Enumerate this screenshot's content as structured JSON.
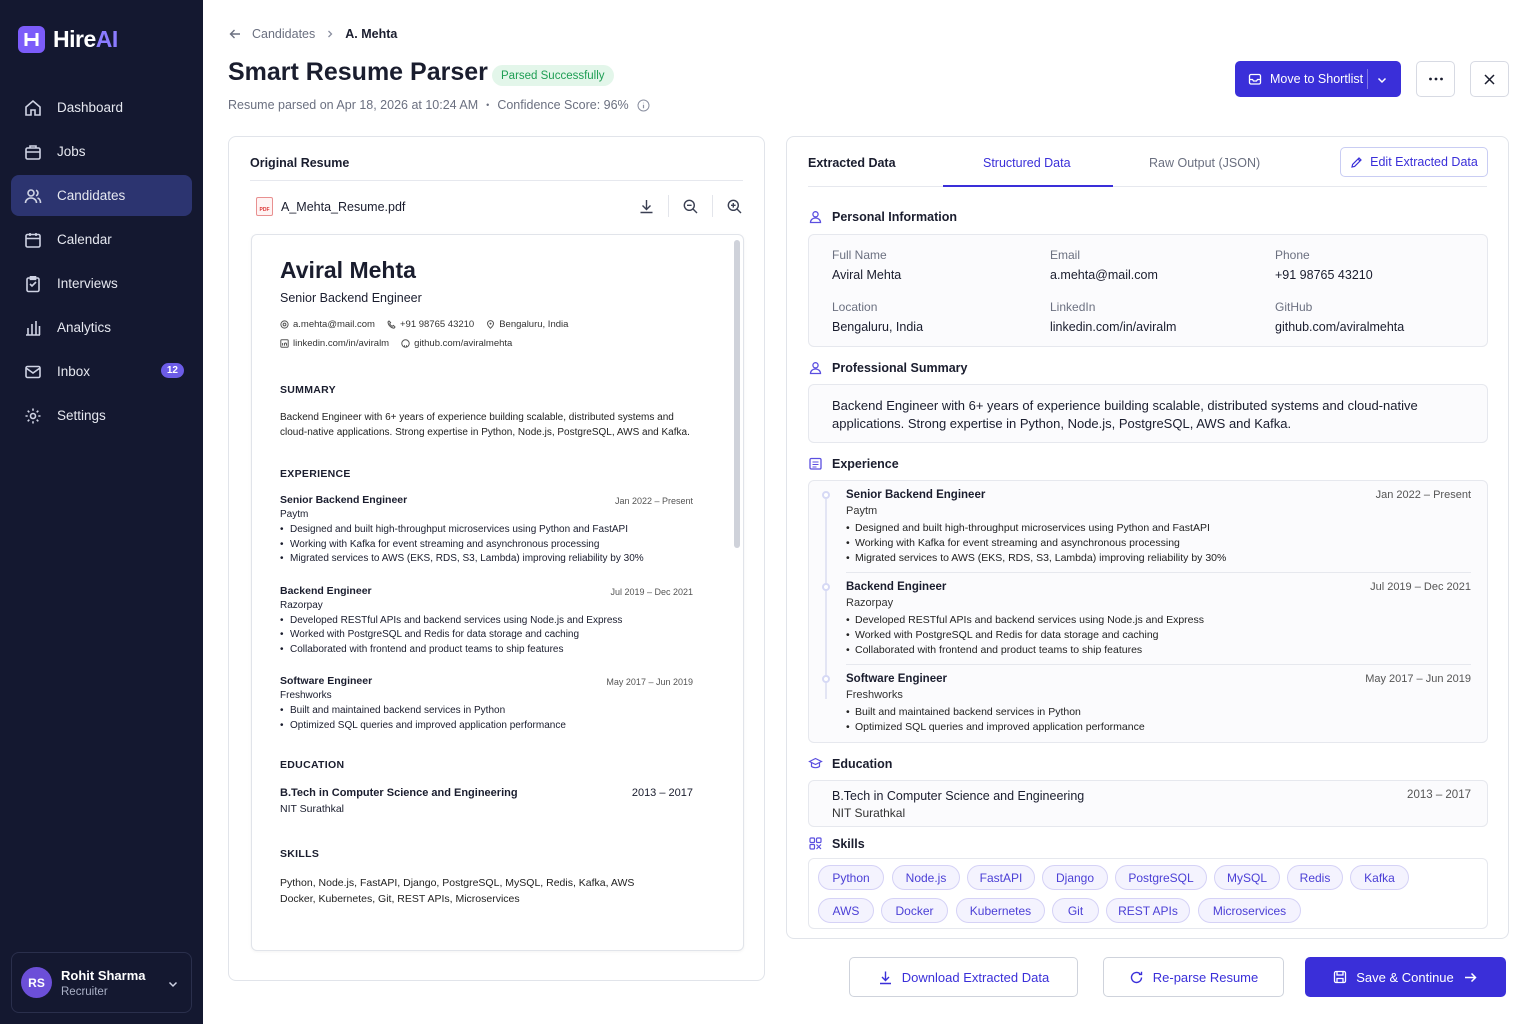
{
  "app": {
    "brand_a": "Hire",
    "brand_b": "AI"
  },
  "nav": {
    "items": [
      {
        "label": "Dashboard",
        "icon": "home-icon"
      },
      {
        "label": "Jobs",
        "icon": "briefcase-icon"
      },
      {
        "label": "Candidates",
        "icon": "users-icon",
        "active": true
      },
      {
        "label": "Calendar",
        "icon": "calendar-icon"
      },
      {
        "label": "Interviews",
        "icon": "clipboard-icon"
      },
      {
        "label": "Analytics",
        "icon": "bar-chart-icon"
      },
      {
        "label": "Inbox",
        "icon": "mail-icon",
        "badge": "12"
      },
      {
        "label": "Settings",
        "icon": "gear-icon"
      }
    ]
  },
  "user": {
    "initials": "RS",
    "name": "Rohit Sharma",
    "role": "Recruiter"
  },
  "breadcrumb": {
    "parent": "Candidates",
    "current": "A. Mehta"
  },
  "header": {
    "title": "Smart Resume Parser",
    "status": "Parsed Successfully",
    "parsed_on": "Resume parsed on Apr 18, 2026 at 10:24 AM",
    "dot": "•",
    "confidence": "Confidence Score: 96%",
    "primary_action": "Move to Shortlist"
  },
  "original": {
    "title": "Original Resume",
    "file_name": "A_Mehta_Resume.pdf",
    "pdf_label": "PDF",
    "doc": {
      "name": "Aviral Mehta",
      "role": "Senior Backend Engineer",
      "email": "a.mehta@mail.com",
      "phone": "+91 98765 43210",
      "location": "Bengaluru, India",
      "linkedin": "linkedin.com/in/aviralm",
      "github": "github.com/aviralmehta",
      "summary_h": "SUMMARY",
      "summary": "Backend Engineer with 6+ years of experience building scalable, distributed systems and cloud-native applications. Strong expertise in Python, Node.js, PostgreSQL, AWS and Kafka.",
      "experience_h": "EXPERIENCE",
      "jobs": [
        {
          "title": "Senior Backend Engineer",
          "company": "Paytm",
          "dates": "Jan 2022 – Present",
          "bullets": [
            "Designed and built high-throughput microservices using Python and FastAPI",
            "Working with Kafka for event streaming and asynchronous processing",
            "Migrated services to AWS (EKS, RDS, S3, Lambda) improving reliability by 30%"
          ]
        },
        {
          "title": "Backend Engineer",
          "company": "Razorpay",
          "dates": "Jul 2019 – Dec 2021",
          "bullets": [
            "Developed RESTful APIs and backend services using Node.js and Express",
            "Worked with PostgreSQL and Redis for data storage and caching",
            "Collaborated with frontend and product teams to ship features"
          ]
        },
        {
          "title": "Software Engineer",
          "company": "Freshworks",
          "dates": "May 2017 – Jun 2019",
          "bullets": [
            "Built and maintained backend services in Python",
            "Optimized SQL queries and improved application performance"
          ]
        }
      ],
      "education_h": "EDUCATION",
      "degree": "B.Tech in Computer Science and Engineering",
      "degree_dates": "2013 – 2017",
      "school": "NIT Surathkal",
      "skills_h": "SKILLS",
      "skills_line1": "Python, Node.js, FastAPI, Django, PostgreSQL, MySQL, Redis, Kafka, AWS",
      "skills_line2": "Docker, Kubernetes, Git, REST APIs, Microservices"
    }
  },
  "extracted": {
    "title": "Extracted Data",
    "tabs": [
      "Structured Data",
      "Raw Output (JSON)"
    ],
    "edit_label": "Edit Extracted Data",
    "personal_h": "Personal Information",
    "personal": [
      {
        "label": "Full Name",
        "value": "Aviral Mehta"
      },
      {
        "label": "Email",
        "value": "a.mehta@mail.com"
      },
      {
        "label": "Phone",
        "value": "+91 98765 43210"
      },
      {
        "label": "Location",
        "value": "Bengaluru, India"
      },
      {
        "label": "LinkedIn",
        "value": "linkedin.com/in/aviralm"
      },
      {
        "label": "GitHub",
        "value": "github.com/aviralmehta"
      }
    ],
    "summary_h": "Professional Summary",
    "summary": "Backend Engineer with 6+ years of experience building scalable, distributed systems and cloud-native applications. Strong expertise in Python, Node.js, PostgreSQL, AWS and Kafka.",
    "experience_h": "Experience",
    "education_h": "Education",
    "degree": "B.Tech in Computer Science and Engineering",
    "school": "NIT Surathkal",
    "degree_dates": "2013 – 2017",
    "skills_h": "Skills",
    "skills": [
      "Python",
      "Node.js",
      "FastAPI",
      "Django",
      "PostgreSQL",
      "MySQL",
      "Redis",
      "Kafka",
      "AWS",
      "Docker",
      "Kubernetes",
      "Git",
      "REST APIs",
      "Microservices"
    ]
  },
  "actions": {
    "download": "Download Extracted Data",
    "reparse": "Re-parse Resume",
    "save": "Save & Continue"
  },
  "colors": {
    "accent": "#3a2fd9",
    "sidebar": "#141830",
    "success": "#1e9e54"
  }
}
